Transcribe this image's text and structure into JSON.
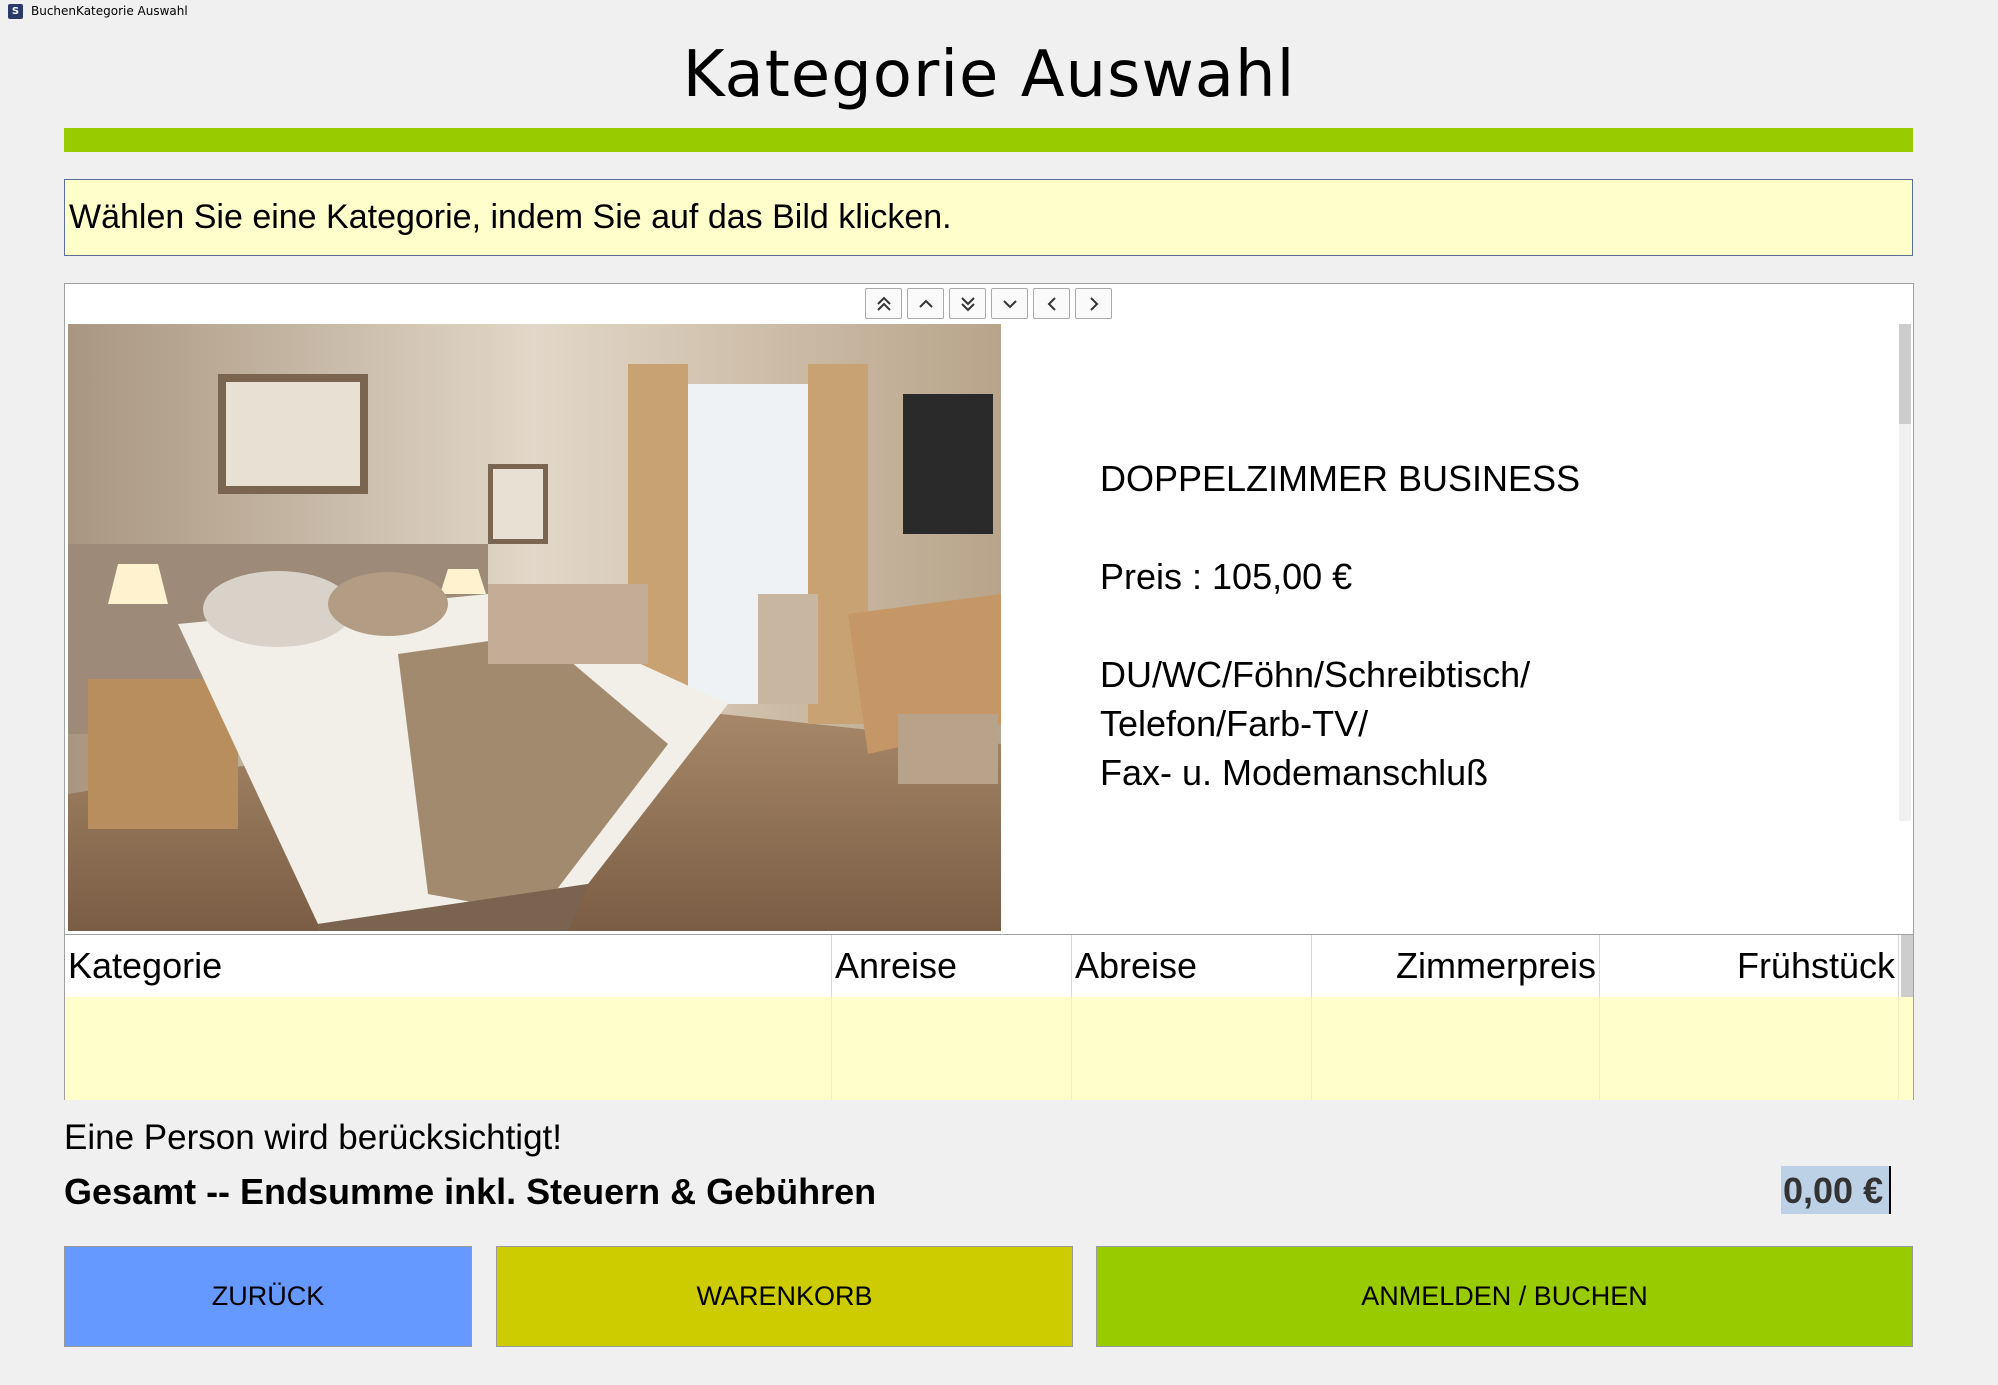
{
  "window": {
    "title": "BuchenKategorie Auswahl",
    "icon": "app-icon"
  },
  "page": {
    "title": "Kategorie Auswahl"
  },
  "hint": "Wählen Sie eine Kategorie, indem Sie auf das Bild klicken.",
  "nav_buttons": [
    "double-up-icon",
    "up-icon",
    "double-down-icon",
    "down-icon",
    "left-icon",
    "right-icon"
  ],
  "room": {
    "name": "DOPPELZIMMER BUSINESS",
    "price": "Preis : 105,00 €",
    "features": [
      "DU/WC/Föhn/Schreibtisch/",
      "Telefon/Farb-TV/",
      "Fax- u. Modemanschluß"
    ]
  },
  "table": {
    "columns": [
      "Kategorie",
      "Anreise",
      "Abreise",
      "Zimmerpreis",
      "Frühstück"
    ],
    "rows": []
  },
  "summary": {
    "persons_note": "Eine Person wird berücksichtigt!",
    "total_label": "Gesamt -- Endsumme inkl. Steuern & Gebühren",
    "total_value": "0,00 €"
  },
  "buttons": {
    "back": "ZURÜCK",
    "cart": "WARENKORB",
    "book": "ANMELDEN / BUCHEN"
  },
  "colors": {
    "accent_green": "#99cc00",
    "hint_bg": "#ffffcc",
    "back_button": "#6699ff",
    "cart_button": "#cccc00",
    "book_button": "#99cc00"
  }
}
